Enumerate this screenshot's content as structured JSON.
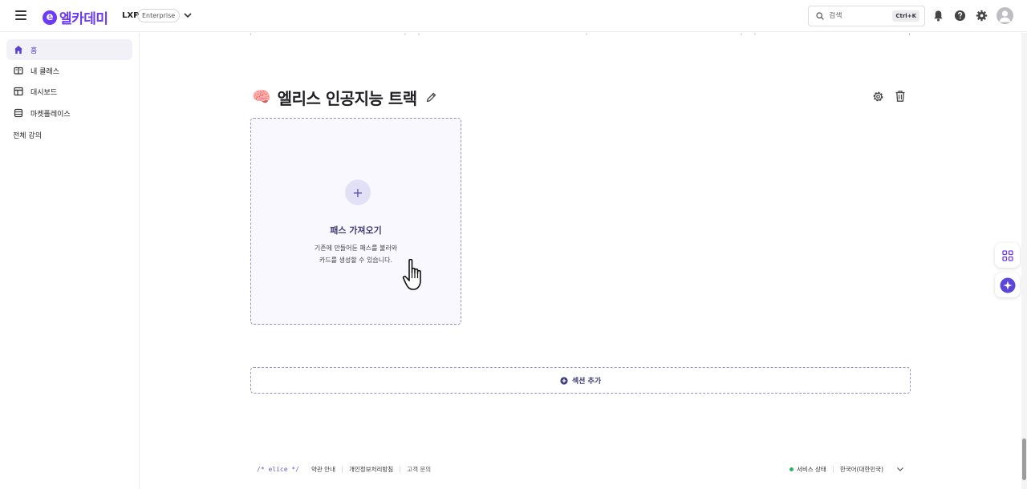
{
  "header": {
    "logo_mark": "e",
    "logo_text": "엘카데미",
    "product": "LXP",
    "plan": "Enterprise",
    "search": {
      "placeholder": "검색",
      "shortcut": "Ctrl+K"
    }
  },
  "sidebar": {
    "items": [
      {
        "label": "홈",
        "icon": "home-icon",
        "active": true
      },
      {
        "label": "내 클래스",
        "icon": "book-icon",
        "active": false
      },
      {
        "label": "대시보드",
        "icon": "dashboard-icon",
        "active": false
      },
      {
        "label": "마켓플레이스",
        "icon": "store-icon",
        "active": false
      }
    ],
    "section_label": "전체 강의"
  },
  "main": {
    "track_emoji": "🧠",
    "track_title": "엘리스 인공지능 트랙",
    "import_card": {
      "title": "패스 가져오기",
      "desc_line1": "기존에 만들어둔 패스를 불러와",
      "desc_line2": "카드를 생성할 수 있습니다."
    },
    "add_section_label": "섹션 추가"
  },
  "footer": {
    "logo": "/* elice */",
    "links": [
      "약관 안내",
      "개인정보처리방침",
      "고객 문의"
    ],
    "service_status": "서비스 상태",
    "language": "한국어(대한민국)"
  },
  "colors": {
    "brand": "#6c3bf5",
    "accent_text": "#3f3a7a",
    "status_ok": "#2fb36b"
  }
}
